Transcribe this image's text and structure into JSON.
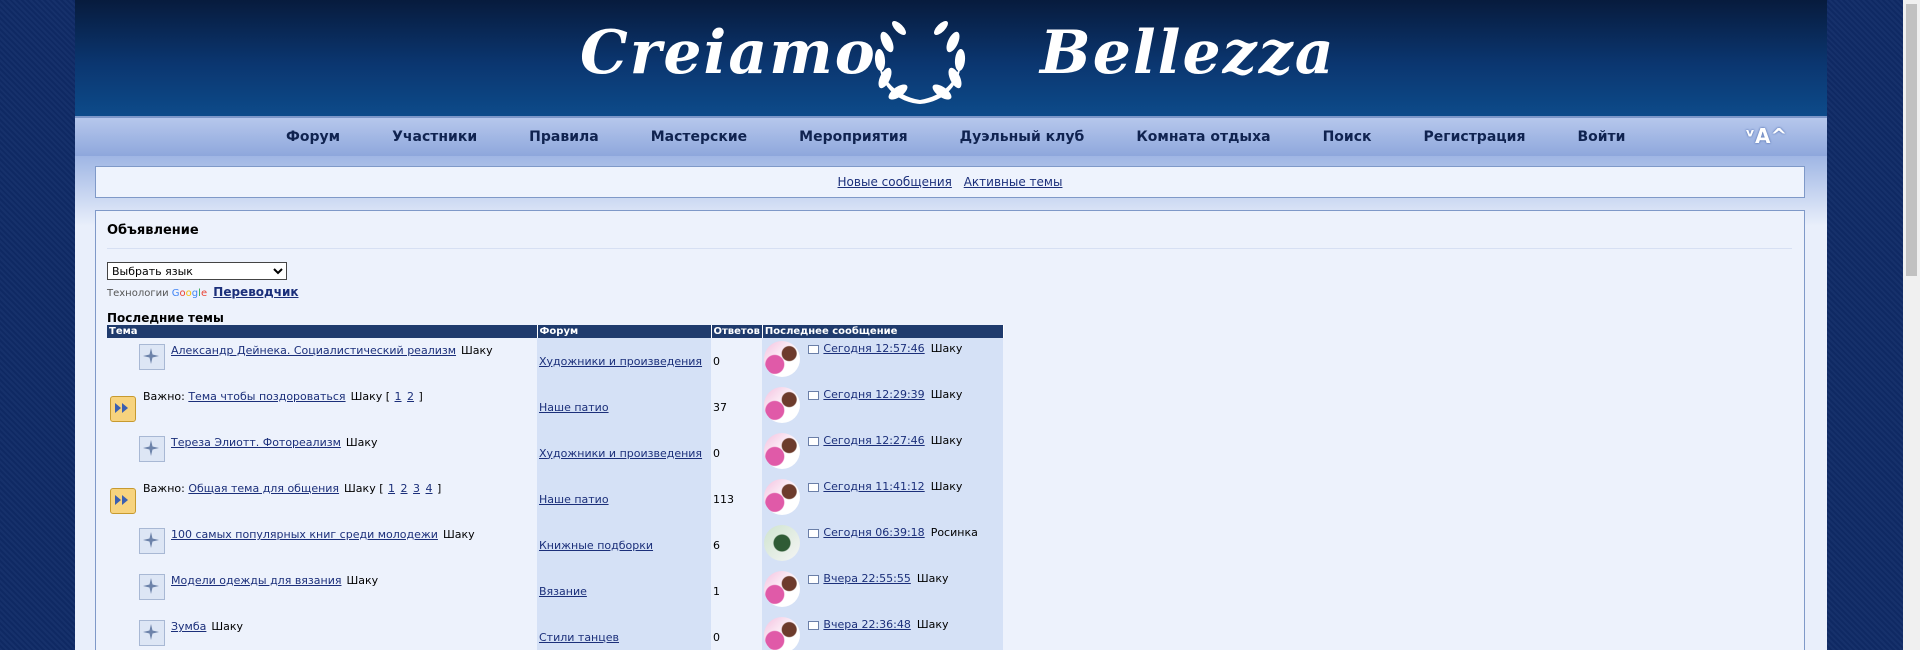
{
  "banner": {
    "title_left": "Creiamo",
    "title_right": "Bellezza"
  },
  "nav": {
    "items": [
      "Форум",
      "Участники",
      "Правила",
      "Мастерские",
      "Мероприятия",
      "Дуэльный клуб",
      "Комната отдыха",
      "Поиск",
      "Регистрация",
      "Войти"
    ],
    "font_control": "ᵛA^"
  },
  "quicklinks": {
    "new_posts": "Новые сообщения",
    "active_topics": "Активные темы"
  },
  "announcement": {
    "title": "Объявление",
    "language_select": "Выбрать язык",
    "powered_prefix": "Технологии",
    "google": [
      "G",
      "o",
      "o",
      "g",
      "l",
      "e"
    ],
    "translator": "Переводчик"
  },
  "recent": {
    "title": "Последние темы",
    "headers": {
      "topic": "Тема",
      "forum": "Форум",
      "replies": "Ответов",
      "last": "Последнее сообщение"
    },
    "sticky_prefix": "Важно:",
    "rows": [
      {
        "sticky": false,
        "title": "Александр Дейнека. Социалистический реализм",
        "author": "Шаку",
        "pages": [],
        "forum": "Художники и произведения",
        "replies": "0",
        "last_time": "Сегодня 12:57:46",
        "last_author": "Шаку",
        "avatar": "rose"
      },
      {
        "sticky": true,
        "title": "Тема чтобы поздороваться",
        "author": "Шаку",
        "pages": [
          "1",
          "2"
        ],
        "forum": "Наше патио",
        "replies": "37",
        "last_time": "Сегодня 12:29:39",
        "last_author": "Шаку",
        "avatar": "rose"
      },
      {
        "sticky": false,
        "title": "Тереза Элиотт. Фотореализм",
        "author": "Шаку",
        "pages": [],
        "forum": "Художники и произведения",
        "replies": "0",
        "last_time": "Сегодня 12:27:46",
        "last_author": "Шаку",
        "avatar": "rose"
      },
      {
        "sticky": true,
        "title": "Общая тема для общения",
        "author": "Шаку",
        "pages": [
          "1",
          "2",
          "3",
          "4"
        ],
        "forum": "Наше патио",
        "replies": "113",
        "last_time": "Сегодня 11:41:12",
        "last_author": "Шаку",
        "avatar": "rose"
      },
      {
        "sticky": false,
        "title": "100 самых популярных книг среди молодежи",
        "author": "Шаку",
        "pages": [],
        "forum": "Книжные подборки",
        "replies": "6",
        "last_time": "Сегодня 06:39:18",
        "last_author": "Росинка",
        "avatar": "green"
      },
      {
        "sticky": false,
        "title": "Модели одежды для вязания",
        "author": "Шаку",
        "pages": [],
        "forum": "Вязание",
        "replies": "1",
        "last_time": "Вчера 22:55:55",
        "last_author": "Шаку",
        "avatar": "rose"
      },
      {
        "sticky": false,
        "title": "Зумба",
        "author": "Шаку",
        "pages": [],
        "forum": "Стили танцев",
        "replies": "0",
        "last_time": "Вчера 22:36:48",
        "last_author": "Шаку",
        "avatar": "rose"
      }
    ]
  }
}
